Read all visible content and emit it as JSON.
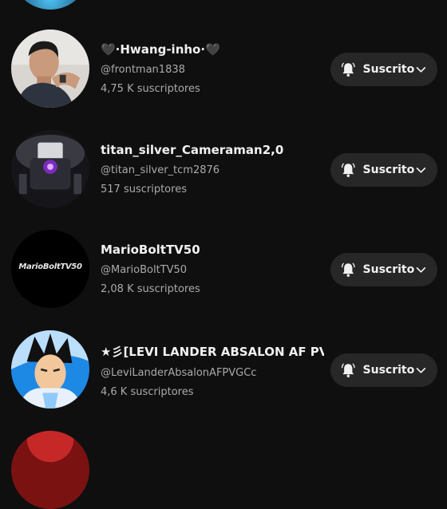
{
  "subscriptions": [
    {
      "name": "🖤·Hwang-inho·🖤",
      "handle": "@frontman1838",
      "subscribers": "4,75 K suscriptores",
      "button_label": "Suscrito"
    },
    {
      "name": "titan_silver_Cameraman2,0",
      "handle": "@titan_silver_tcm2876",
      "subscribers": "517 suscriptores",
      "button_label": "Suscrito"
    },
    {
      "name": "MarioBoltTV50",
      "handle": "@MarioBoltTV50",
      "subscribers": "2,08 K suscriptores",
      "button_label": "Suscrito",
      "avatar_text": "MarioBoltTV50"
    },
    {
      "name": "★彡[LEVI LANDER ABSALON AF PVG CC",
      "handle": "@LeviLanderAbsalonAFPVGCc",
      "subscribers": "4,6 K suscriptores",
      "button_label": "Suscrito"
    }
  ],
  "colors": {
    "background": "#0f0f0f",
    "button_bg": "#272727",
    "secondary_text": "#aaaaaa"
  },
  "icons": [
    "bell-icon",
    "chevron-down-icon"
  ]
}
